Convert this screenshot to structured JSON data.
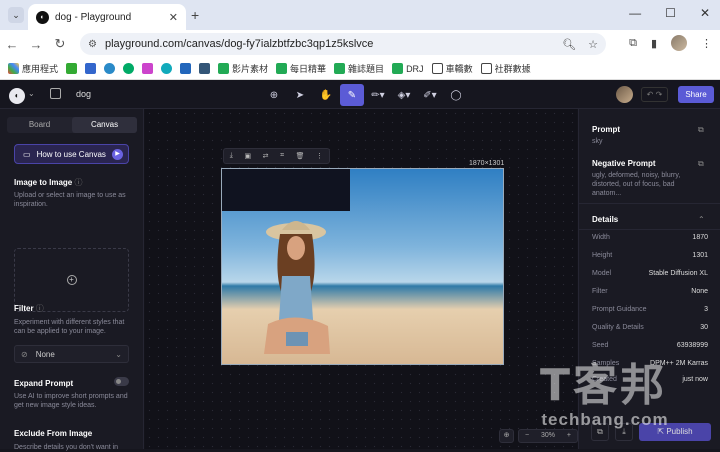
{
  "browser": {
    "tab_title": "dog - Playground",
    "url": "playground.com/canvas/dog-fy7ialzbtfzbc3qp1z5kslvce",
    "bookmarks": [
      "應用程式",
      "",
      "",
      "",
      "",
      "",
      "",
      "",
      "影片素材",
      "每日精華",
      "雜誌題目",
      "DRJ",
      "車轎數",
      "社群數據"
    ]
  },
  "app": {
    "project_name": "dog",
    "share_label": "Share",
    "left": {
      "tabs": [
        "Board",
        "Canvas"
      ],
      "how_to_label": "How to use Canvas",
      "image_to_image_title": "Image to Image",
      "image_to_image_desc": "Upload or select an image to use as inspiration.",
      "filter_title": "Filter",
      "filter_desc": "Experiment with different styles that can be applied to your image.",
      "filter_value": "None",
      "expand_title": "Expand Prompt",
      "expand_desc": "Use AI to improve short prompts and get new image style ideas.",
      "exclude_title": "Exclude From Image",
      "exclude_desc": "Describe details you don't want in"
    },
    "canvas": {
      "dimensions": "1870×1301",
      "zoom": "30%"
    },
    "right": {
      "prompt_title": "Prompt",
      "prompt_value": "sky",
      "neg_title": "Negative Prompt",
      "neg_value": "ugly, deformed, noisy, blurry, distorted, out of focus, bad anatom...",
      "details_title": "Details",
      "details": [
        {
          "k": "Width",
          "v": "1870"
        },
        {
          "k": "Height",
          "v": "1301"
        },
        {
          "k": "Model",
          "v": "Stable Diffusion XL"
        },
        {
          "k": "Filter",
          "v": "None"
        },
        {
          "k": "Prompt Guidance",
          "v": "3"
        },
        {
          "k": "Quality & Details",
          "v": "30"
        },
        {
          "k": "Seed",
          "v": "63938999"
        },
        {
          "k": "Samples",
          "v": "DPM++ 2M Karras"
        },
        {
          "k": "Created",
          "v": "just now"
        }
      ],
      "publish_label": "Publish"
    }
  },
  "watermark": {
    "big": "T客邦",
    "small": "techbang.com"
  }
}
